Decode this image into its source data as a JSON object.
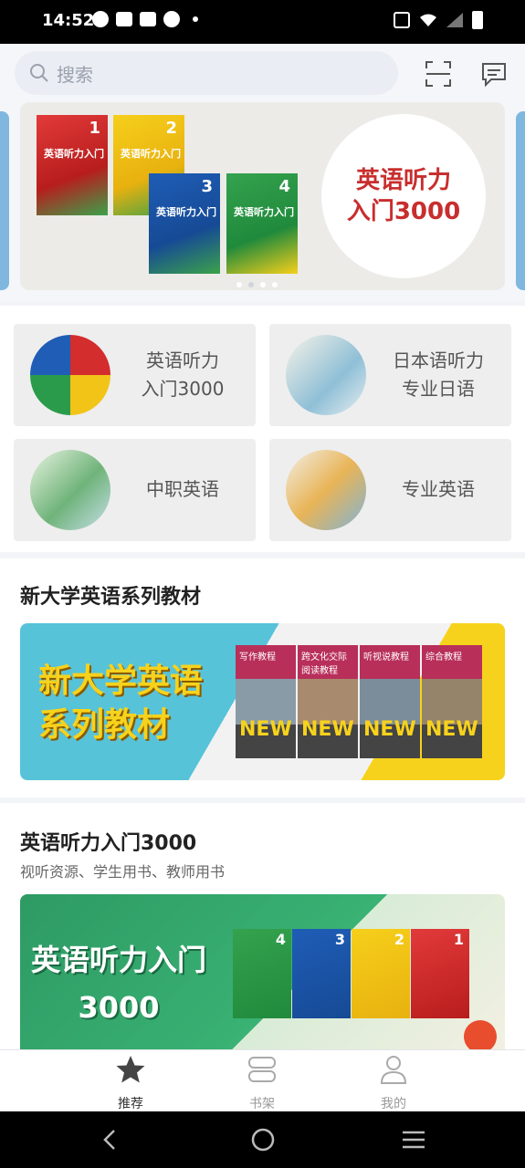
{
  "status_bar": {
    "time": "14:52"
  },
  "search": {
    "placeholder": "搜索"
  },
  "carousel": {
    "title_line1": "英语听力",
    "title_line2": "入门3000",
    "book_numbers": [
      "1",
      "2",
      "3",
      "4"
    ],
    "book_title": "英语听力入门",
    "active_dot": 1
  },
  "categories": [
    {
      "line1": "英语听力",
      "line2": "入门3000"
    },
    {
      "line1": "日本语听力",
      "line2": "专业日语"
    },
    {
      "line1": "中职英语",
      "line2": ""
    },
    {
      "line1": "专业英语",
      "line2": ""
    }
  ],
  "section1": {
    "title": "新大学英语系列教材",
    "banner_line1": "新大学英语",
    "banner_line2": "系列教材",
    "book_titles": [
      "写作教程",
      "跨文化交际阅读教程",
      "听视说教程",
      "综合教程"
    ],
    "brand": "NEW"
  },
  "section2": {
    "title": "英语听力入门3000",
    "subtitle": "视听资源、学生用书、教师用书",
    "banner_line1": "英语听力入门",
    "banner_line2": "3000",
    "book_numbers": [
      "4",
      "3",
      "2",
      "1"
    ]
  },
  "tabs": [
    {
      "label": "推荐",
      "icon": "star-icon",
      "active": true
    },
    {
      "label": "书架",
      "icon": "bookshelf-icon",
      "active": false
    },
    {
      "label": "我的",
      "icon": "person-icon",
      "active": false
    }
  ],
  "colors": {
    "accent_red": "#c82e2e",
    "banner_yellow": "#f7d21c",
    "banner_green": "#2e9a64"
  }
}
